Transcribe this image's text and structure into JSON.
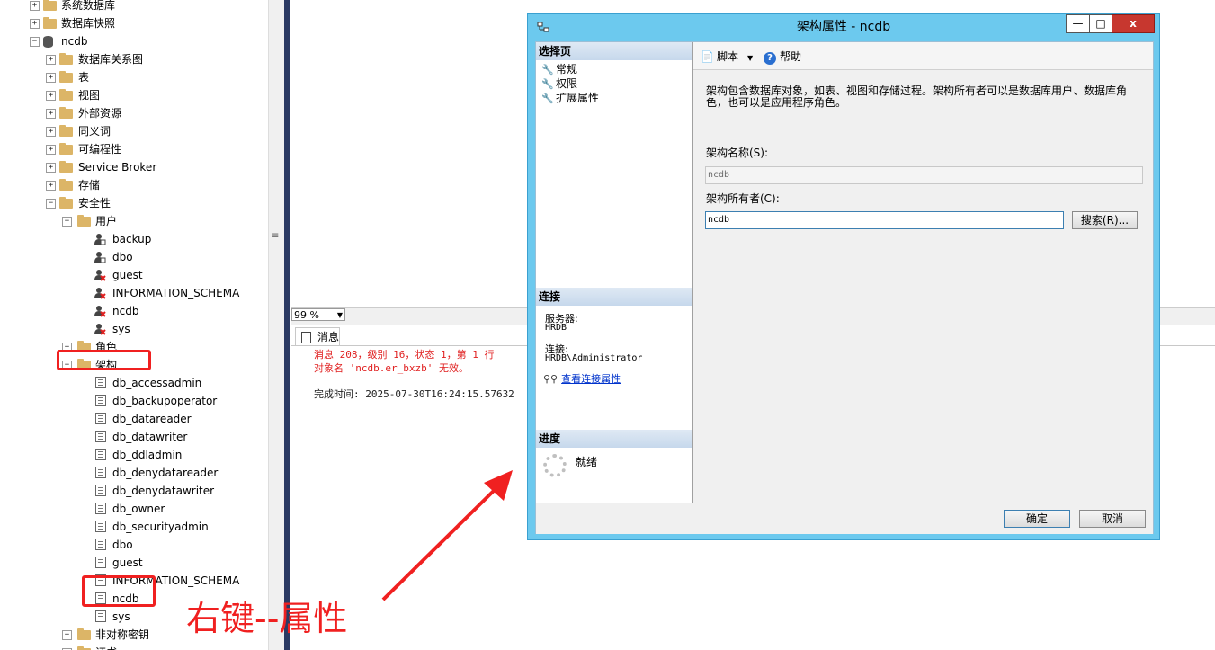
{
  "tree": {
    "items": [
      {
        "label": "系统数据库",
        "expander": "+"
      },
      {
        "label": "数据库快照",
        "expander": "+"
      },
      {
        "label": "ncdb",
        "expander": "−"
      },
      {
        "label": "数据库关系图",
        "expander": "+"
      },
      {
        "label": "表",
        "expander": "+"
      },
      {
        "label": "视图",
        "expander": "+"
      },
      {
        "label": "外部资源",
        "expander": "+"
      },
      {
        "label": "同义词",
        "expander": "+"
      },
      {
        "label": "可编程性",
        "expander": "+"
      },
      {
        "label": "Service Broker",
        "expander": "+"
      },
      {
        "label": "存储",
        "expander": "+"
      },
      {
        "label": "安全性",
        "expander": "−"
      },
      {
        "label": "用户",
        "expander": "−"
      },
      {
        "label": "backup"
      },
      {
        "label": "dbo"
      },
      {
        "label": "guest"
      },
      {
        "label": "INFORMATION_SCHEMA"
      },
      {
        "label": "ncdb"
      },
      {
        "label": "sys"
      },
      {
        "label": "角色",
        "expander": "+"
      },
      {
        "label": "架构",
        "expander": "−"
      },
      {
        "label": "db_accessadmin"
      },
      {
        "label": "db_backupoperator"
      },
      {
        "label": "db_datareader"
      },
      {
        "label": "db_datawriter"
      },
      {
        "label": "db_ddladmin"
      },
      {
        "label": "db_denydatareader"
      },
      {
        "label": "db_denydatawriter"
      },
      {
        "label": "db_owner"
      },
      {
        "label": "db_securityadmin"
      },
      {
        "label": "dbo"
      },
      {
        "label": "guest"
      },
      {
        "label": "INFORMATION_SCHEMA"
      },
      {
        "label": "ncdb"
      },
      {
        "label": "sys"
      },
      {
        "label": "非对称密钥",
        "expander": "+"
      },
      {
        "label": "证书",
        "expander": "+"
      }
    ]
  },
  "editor": {
    "zoom": "99 %",
    "messages_tab": "消息",
    "error_line1": "消息 208，级别 16，状态 1，第 1 行",
    "error_line2": "对象名 'ncdb.er_bxzb' 无效。",
    "completion": "完成时间: 2025-07-30T16:24:15.57632"
  },
  "annotation": {
    "text": "右键--属性"
  },
  "dialog": {
    "title": "架构属性 - ncdb",
    "min_glyph": "—",
    "max_glyph": "□",
    "close_glyph": "x",
    "select_page_header": "选择页",
    "pages": [
      "常规",
      "权限",
      "扩展属性"
    ],
    "connection_header": "连接",
    "server_label": "服务器:",
    "server_value": "HRDB",
    "connection_label": "连接:",
    "connection_value": "HRDB\\Administrator",
    "view_conn_link": "查看连接属性",
    "progress_header": "进度",
    "progress_status": "就绪",
    "toolbar_script": "脚本",
    "toolbar_help": "帮助",
    "description": "架构包含数据库对象，如表、视图和存储过程。架构所有者可以是数据库用户、数据库角色，也可以是应用程序角色。",
    "schema_name_label": "架构名称(S):",
    "schema_name_value": "ncdb",
    "schema_owner_label": "架构所有者(C):",
    "schema_owner_value": "ncdb",
    "search_button": "搜索(R)...",
    "ok_button": "确定",
    "cancel_button": "取消"
  },
  "colors": {
    "annotation_red": "#f02020",
    "dialog_frame": "#6cc9ee",
    "error_text": "#e02020",
    "link": "#0033cc"
  }
}
